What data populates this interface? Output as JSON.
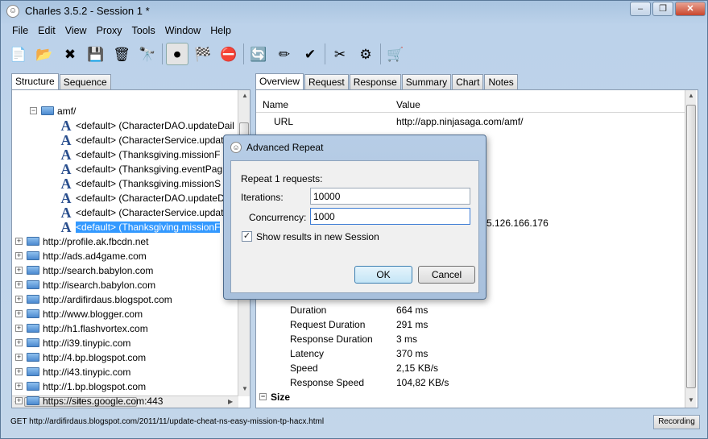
{
  "window": {
    "title": "Charles 3.5.2 - Session 1 *",
    "buttons": [
      "–",
      "❐",
      "✕"
    ]
  },
  "menu": [
    "File",
    "Edit",
    "View",
    "Proxy",
    "Tools",
    "Window",
    "Help"
  ],
  "toolbar": [
    {
      "name": "new-session-icon",
      "glyph": "📄"
    },
    {
      "name": "open-session-icon",
      "glyph": "📂"
    },
    {
      "name": "close-session-icon",
      "glyph": "✖"
    },
    {
      "name": "save-session-icon",
      "glyph": "💾"
    },
    {
      "name": "clear-session-icon",
      "glyph": "🗑"
    },
    {
      "name": "find-icon",
      "glyph": "🔭"
    },
    {
      "name": "record-icon",
      "glyph": "⏺"
    },
    {
      "name": "throttle-icon",
      "glyph": "🏁"
    },
    {
      "name": "breakpoints-icon",
      "glyph": "⛔"
    },
    {
      "name": "repeat-icon",
      "glyph": "🔄"
    },
    {
      "name": "edit-icon",
      "glyph": "✏"
    },
    {
      "name": "validate-icon",
      "glyph": "✔"
    },
    {
      "name": "tools-icon",
      "glyph": "✂"
    },
    {
      "name": "settings-icon",
      "glyph": "⚙"
    },
    {
      "name": "shopping-cart-icon",
      "glyph": "🛒"
    }
  ],
  "left_tabs": [
    "Structure",
    "Sequence"
  ],
  "tree": {
    "folder": "amf/",
    "items": [
      "<default> (CharacterDAO.updateDail",
      "<default> (CharacterService.updateC",
      "<default> (Thanksgiving.missionF",
      "<default> (Thanksgiving.eventPag",
      "<default> (Thanksgiving.missionS",
      "<default> (CharacterDAO.updateD",
      "<default> (CharacterService.updat",
      "<default> (Thanksgiving.missionF"
    ],
    "hosts": [
      "http://profile.ak.fbcdn.net",
      "http://ads.ad4game.com",
      "http://search.babylon.com",
      "http://isearch.babylon.com",
      "http://ardifirdaus.blogspot.com",
      "http://www.blogger.com",
      "http://h1.flashvortex.com",
      "http://i39.tinypic.com",
      "http://4.bp.blogspot.com",
      "http://i43.tinypic.com",
      "http://1.bp.blogspot.com",
      "https://sites.google.com:443"
    ],
    "scroll_h_label": "III"
  },
  "right_tabs": [
    "Overview",
    "Request",
    "Response",
    "Summary",
    "Chart",
    "Notes"
  ],
  "grid": {
    "col_name": "Name",
    "col_value": "Value",
    "url_label": "URL",
    "url_value": "http://app.ninjasaga.com/amf/",
    "partial_value": "5.126.166.176",
    "timing": [
      {
        "name": "Duration",
        "value": "664 ms"
      },
      {
        "name": "Request Duration",
        "value": "291 ms"
      },
      {
        "name": "Response Duration",
        "value": "3 ms"
      },
      {
        "name": "Latency",
        "value": "370 ms"
      },
      {
        "name": "Speed",
        "value": "2,15 KB/s"
      },
      {
        "name": "Response Speed",
        "value": "104,82 KB/s"
      }
    ],
    "size_label": "Size"
  },
  "status": {
    "url": "GET http://ardifirdaus.blogspot.com/2011/11/update-cheat-ns-easy-mission-tp-hacx.html",
    "recording": "Recording"
  },
  "dialog": {
    "title": "Advanced Repeat",
    "repeat_text": "Repeat 1 requests:",
    "iterations_label": "Iterations:",
    "iterations_value": "10000",
    "concurrency_label": "Concurrency:",
    "concurrency_value": "1000",
    "checkbox_label": "Show results in new Session",
    "checkbox_checked": true,
    "ok": "OK",
    "cancel": "Cancel"
  }
}
